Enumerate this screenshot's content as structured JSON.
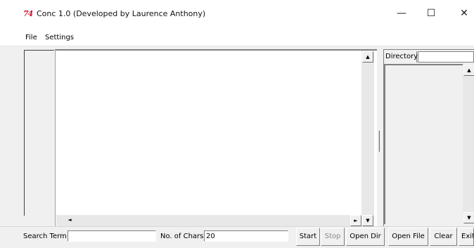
{
  "window": {
    "title": "Conc 1.0 (Developed by Laurence Anthony)",
    "icon_name": "app-logo-icon",
    "icon_glyph": "74",
    "controls": {
      "minimize": "—",
      "maximize": "☐",
      "close": "✕"
    }
  },
  "menu": {
    "items": [
      "File",
      "Settings"
    ]
  },
  "main_view": {
    "text": "",
    "scroll": {
      "up": "▲",
      "down": "▼",
      "left": "◄",
      "right": "►"
    }
  },
  "directory": {
    "label": "Directory",
    "value": "",
    "scroll": {
      "up": "▲",
      "down": "▼"
    }
  },
  "toolbar": {
    "search_label": "Search Term",
    "search_value": "",
    "chars_label": "No. of Chars",
    "chars_value": "20",
    "buttons": {
      "start": "Start",
      "stop": "Stop",
      "open_dir": "Open Dir",
      "open_file": "Open File",
      "clear": "Clear",
      "exit": "Exit"
    }
  },
  "colors": {
    "icon": "#c8102e",
    "disabled": "#8a8a8a"
  }
}
